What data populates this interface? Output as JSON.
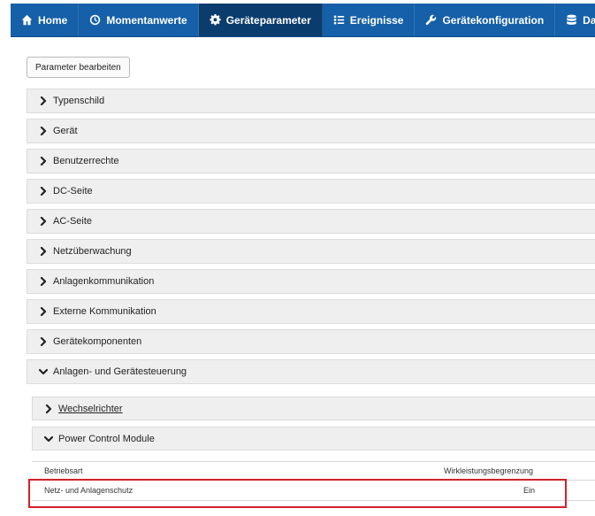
{
  "nav": [
    {
      "label": "Home",
      "icon": "home-icon",
      "active": false
    },
    {
      "label": "Momentanwerte",
      "icon": "clock-icon",
      "active": false
    },
    {
      "label": "Geräteparameter",
      "icon": "gear-icon",
      "active": true
    },
    {
      "label": "Ereignisse",
      "icon": "list-icon",
      "active": false
    },
    {
      "label": "Gerätekonfiguration",
      "icon": "wrench-icon",
      "active": false
    },
    {
      "label": "Daten",
      "icon": "database-icon",
      "active": false
    }
  ],
  "colors": {
    "navbar": "#1560a8",
    "active_tab": "#0b3c6e",
    "highlight": "#d3222a"
  },
  "edit_button_label": "Parameter bearbeiten",
  "groups": [
    {
      "label": "Typenschild",
      "expanded": false
    },
    {
      "label": "Gerät",
      "expanded": false
    },
    {
      "label": "Benutzerrechte",
      "expanded": false
    },
    {
      "label": "DC-Seite",
      "expanded": false
    },
    {
      "label": "AC-Seite",
      "expanded": false
    },
    {
      "label": "Netzüberwachung",
      "expanded": false
    },
    {
      "label": "Anlagenkommunikation",
      "expanded": false
    },
    {
      "label": "Externe Kommunikation",
      "expanded": false
    },
    {
      "label": "Gerätekomponenten",
      "expanded": false
    },
    {
      "label": "Anlagen- und Gerätesteuerung",
      "expanded": true
    }
  ],
  "subgroups": [
    {
      "label": "Wechselrichter",
      "expanded": false
    },
    {
      "label": "Power Control Module",
      "expanded": true
    }
  ],
  "params": {
    "header": {
      "name": "Betriebsart",
      "value": "Wirkleistungsbegrenzung"
    },
    "row": {
      "name": "Netz- und Anlagenschutz",
      "value": "Ein"
    }
  }
}
